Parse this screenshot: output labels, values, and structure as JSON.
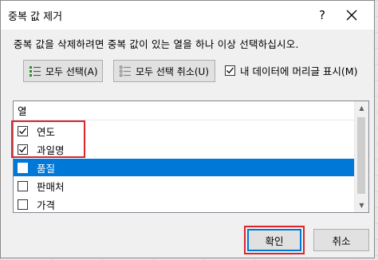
{
  "dialog": {
    "title": "중복 값 제거",
    "help_label": "?",
    "instruction": "중복 값을 삭제하려면 중복 값이 있는 열을 하나 이상 선택하십시오."
  },
  "toolbar": {
    "select_all_label": "모두 선택(A)",
    "unselect_all_label": "모두 선택 취소(U)",
    "headers_label": "내 데이터에 머리글 표시(M)",
    "headers_checked": true
  },
  "columns_list": {
    "header": "열",
    "items": [
      {
        "label": "연도",
        "checked": true,
        "selected": false
      },
      {
        "label": "과일명",
        "checked": true,
        "selected": false
      },
      {
        "label": "품질",
        "checked": false,
        "selected": true
      },
      {
        "label": "판매처",
        "checked": false,
        "selected": false
      },
      {
        "label": "가격",
        "checked": false,
        "selected": false
      }
    ]
  },
  "buttons": {
    "ok_label": "확인",
    "cancel_label": "취소"
  },
  "colors": {
    "selection": "#0078d7",
    "highlight_box": "#d9262c"
  }
}
